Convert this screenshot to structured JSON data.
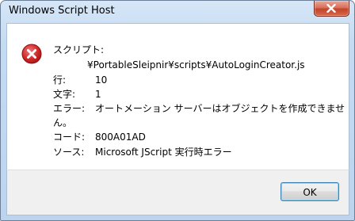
{
  "window": {
    "title": "Windows Script Host"
  },
  "message": {
    "script_label": "スクリプト:",
    "script_path": "¥PortableSleipnir¥scripts¥AutoLoginCreator.js",
    "line_label": "行:",
    "line_value": "10",
    "char_label": "文字:",
    "char_value": "1",
    "error_label": "エラー:",
    "error_text_1": "オートメーション サーバーはオブジェクトを作成できませ",
    "error_text_2": "ん。",
    "code_label": "コード:",
    "code_value": "800A01AD",
    "source_label": "ソース:",
    "source_value": "Microsoft JScript 実行時エラー"
  },
  "buttons": {
    "ok_label": "OK"
  },
  "icons": {
    "error": "error-icon",
    "close": "close-icon"
  },
  "colors": {
    "error_red": "#d22a2a",
    "close_red": "#c2442a",
    "button_focus": "#3c7fb1"
  }
}
